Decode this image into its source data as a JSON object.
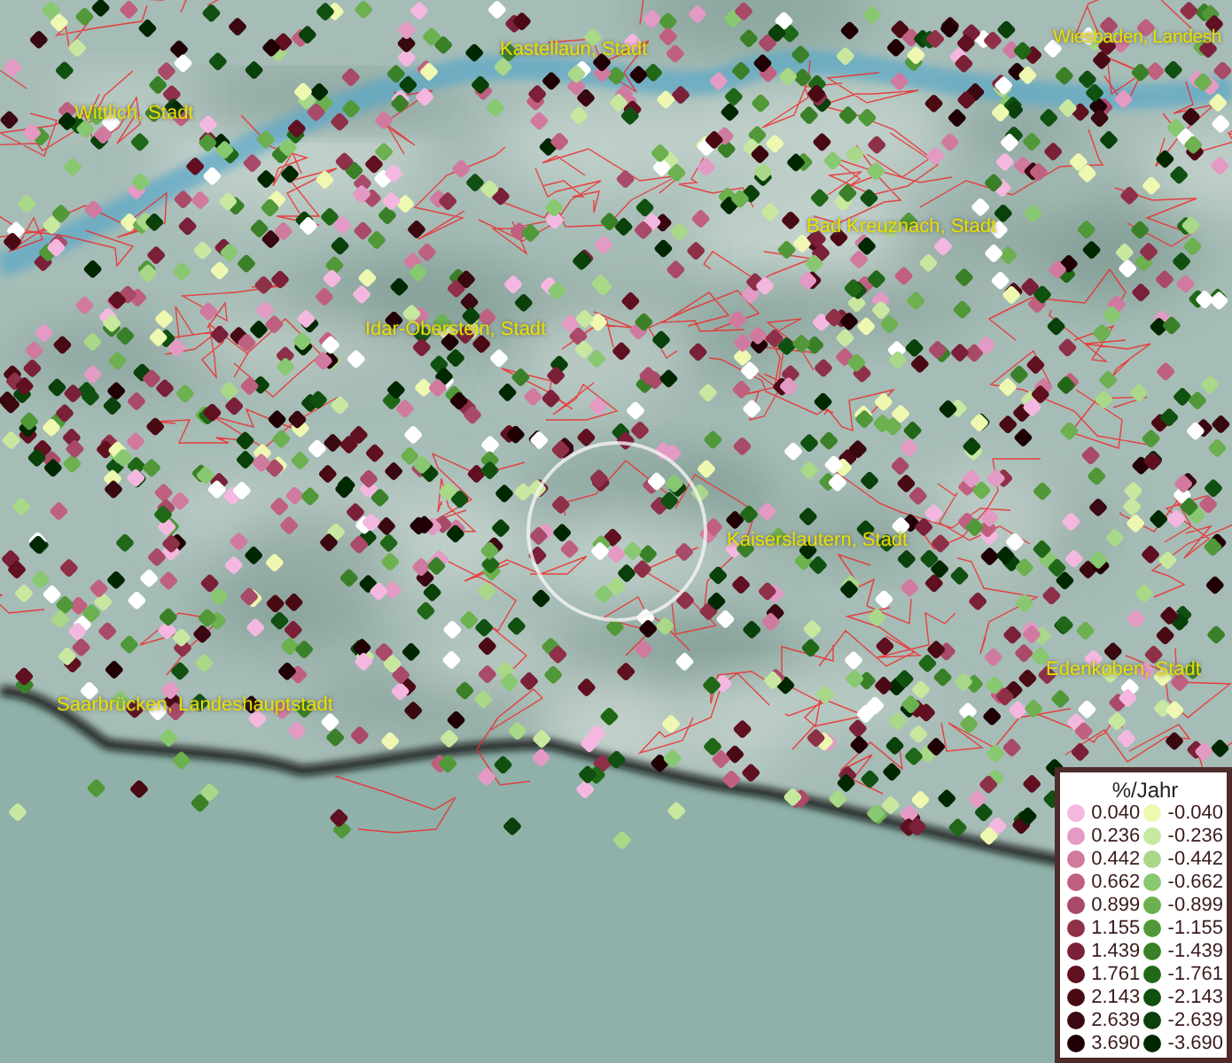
{
  "map": {
    "place_labels": [
      {
        "text": "Kastellaun, Stadt"
      },
      {
        "text": "Wiesbaden, Landesh"
      },
      {
        "text": "Wittlich, Stadt"
      },
      {
        "text": "Bad Kreuznach, Stadt"
      },
      {
        "text": "Idar-Oberstein, Stadt"
      },
      {
        "text": "Kaiserslautern, Stadt"
      },
      {
        "text": "Edenkoben, Stadt"
      },
      {
        "text": "Saarbrücken, Landeshauptstadt"
      }
    ]
  },
  "legend": {
    "title": "%/Jahr",
    "positive": [
      {
        "value": "0.040",
        "color": "#f4b8e0"
      },
      {
        "value": "0.236",
        "color": "#e39ac4"
      },
      {
        "value": "0.442",
        "color": "#d07aa0"
      },
      {
        "value": "0.662",
        "color": "#c06080"
      },
      {
        "value": "0.899",
        "color": "#a84a68"
      },
      {
        "value": "1.155",
        "color": "#8e3048"
      },
      {
        "value": "1.439",
        "color": "#7a2038"
      },
      {
        "value": "1.761",
        "color": "#601020"
      },
      {
        "value": "2.143",
        "color": "#4a0a14"
      },
      {
        "value": "2.639",
        "color": "#3a0810"
      },
      {
        "value": "3.690",
        "color": "#200004"
      }
    ],
    "negative": [
      {
        "value": "-0.040",
        "color": "#eef8b0"
      },
      {
        "value": "-0.236",
        "color": "#c8e8a0"
      },
      {
        "value": "-0.442",
        "color": "#a8d888"
      },
      {
        "value": "-0.662",
        "color": "#88c870"
      },
      {
        "value": "-0.899",
        "color": "#6cb050"
      },
      {
        "value": "-1.155",
        "color": "#509838"
      },
      {
        "value": "-1.439",
        "color": "#3a8028"
      },
      {
        "value": "-1.761",
        "color": "#206818"
      },
      {
        "value": "-2.143",
        "color": "#105010"
      },
      {
        "value": "-2.639",
        "color": "#0a400a"
      },
      {
        "value": "-3.690",
        "color": "#002800"
      }
    ]
  }
}
